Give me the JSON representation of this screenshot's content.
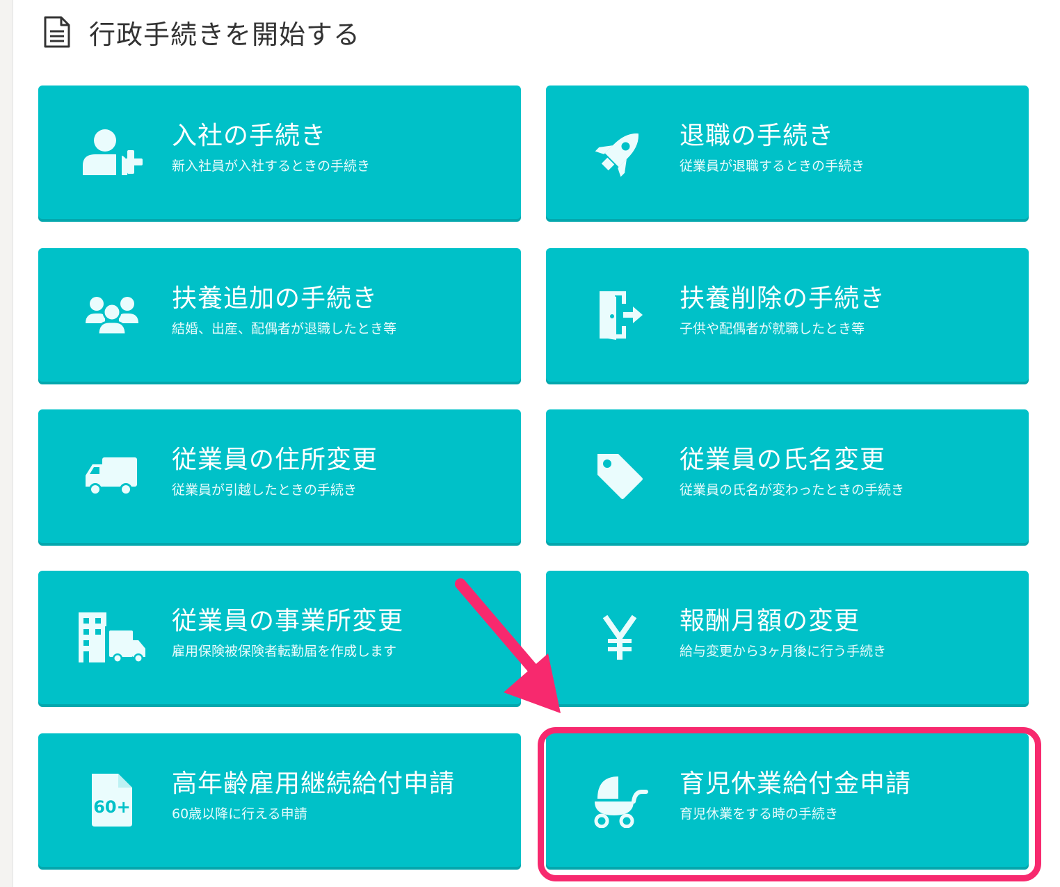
{
  "header": {
    "title": "行政手続きを開始する",
    "icon": "document-icon"
  },
  "cards": [
    {
      "title": "入社の手続き",
      "subtitle": "新入社員が入社するときの手続き",
      "icon": "user-plus-icon"
    },
    {
      "title": "退職の手続き",
      "subtitle": "従業員が退職するときの手続き",
      "icon": "rocket-icon"
    },
    {
      "title": "扶養追加の手続き",
      "subtitle": "結婚、出産、配偶者が退職したとき等",
      "icon": "group-icon"
    },
    {
      "title": "扶養削除の手続き",
      "subtitle": "子供や配偶者が就職したとき等",
      "icon": "exit-door-icon"
    },
    {
      "title": "従業員の住所変更",
      "subtitle": "従業員が引越したときの手続き",
      "icon": "truck-icon"
    },
    {
      "title": "従業員の氏名変更",
      "subtitle": "従業員の氏名が変わったときの手続き",
      "icon": "tag-icon"
    },
    {
      "title": "従業員の事業所変更",
      "subtitle": "雇用保険被保険者転勤届を作成します",
      "icon": "building-truck-icon"
    },
    {
      "title": "報酬月額の変更",
      "subtitle": "給与変更から3ヶ月後に行う手続き",
      "icon": "yen-icon"
    },
    {
      "title": "高年齢雇用継続給付申請",
      "subtitle": "60歳以降に行える申請",
      "icon": "file-60-icon",
      "icon_text": "60+"
    },
    {
      "title": "育児休業給付金申請",
      "subtitle": "育児休業をする時の手続き",
      "icon": "baby-stroller-icon"
    }
  ],
  "colors": {
    "card": "#00c1c8",
    "card_shadow": "#04a7ad",
    "highlight": "#f7296e",
    "text_dark": "#333333"
  }
}
